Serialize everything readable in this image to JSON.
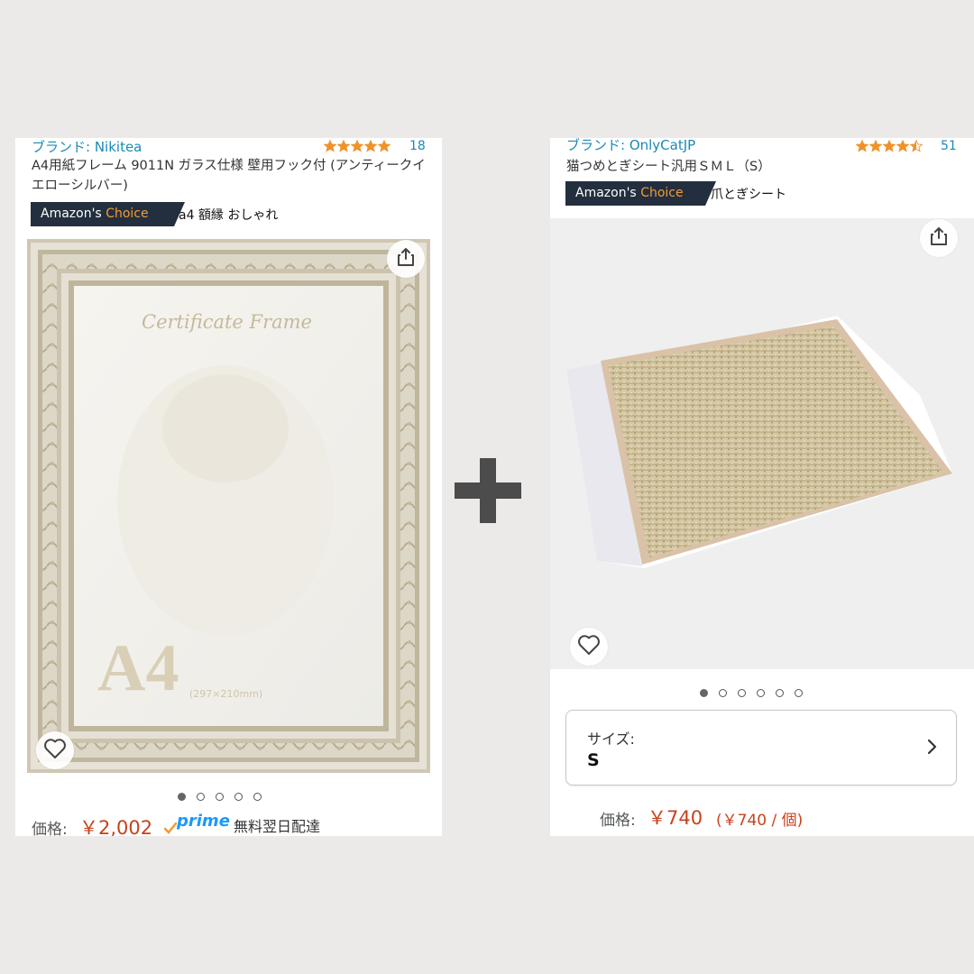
{
  "left_product": {
    "brand": "ブランド: Nikitea",
    "rating": 5,
    "review_count": "18",
    "title": "A4用紙フレーム 9011N ガラス仕様 壁用フック付 (アンティークイエローシルバー)",
    "choice_prefix": "Amazon's ",
    "choice_word": "Choice",
    "choice_keyword": "a4 額縁 おしゃれ",
    "image_title": "Certificate Frame",
    "image_size_big": "A4",
    "image_size_dims": "(297×210mm)",
    "carousel_active": 0,
    "carousel_count": 5,
    "price_label": "価格:",
    "price": "￥2,002",
    "prime": "prime",
    "delivery": "無料翌日配達",
    "icons": {
      "share": "share-icon",
      "favorite": "heart-icon",
      "prime_check": "check-icon"
    }
  },
  "right_product": {
    "brand": "ブランド: OnlyCatJP",
    "rating": 4.5,
    "review_count": "51",
    "title": "猫つめとぎシート汎用ＳＭＬ（S）",
    "choice_prefix": "Amazon's ",
    "choice_word": "Choice",
    "choice_keyword": "爪とぎシート",
    "carousel_active": 0,
    "carousel_count": 6,
    "size_label": "サイズ:",
    "size_value": "S",
    "price_label": "価格:",
    "price": "￥740",
    "unit_price": "(￥740 / 個)",
    "icons": {
      "share": "share-icon",
      "favorite": "heart-icon",
      "chevron": "chevron-right-icon"
    }
  },
  "plus_icon": "plus-icon",
  "colors": {
    "background": "#ebeae8",
    "link": "#1a8ab5",
    "star": "#f0922b",
    "price": "#c7421b",
    "badge": "#232f3e",
    "badge_accent": "#f29b36",
    "prime": "#1a98ff"
  }
}
